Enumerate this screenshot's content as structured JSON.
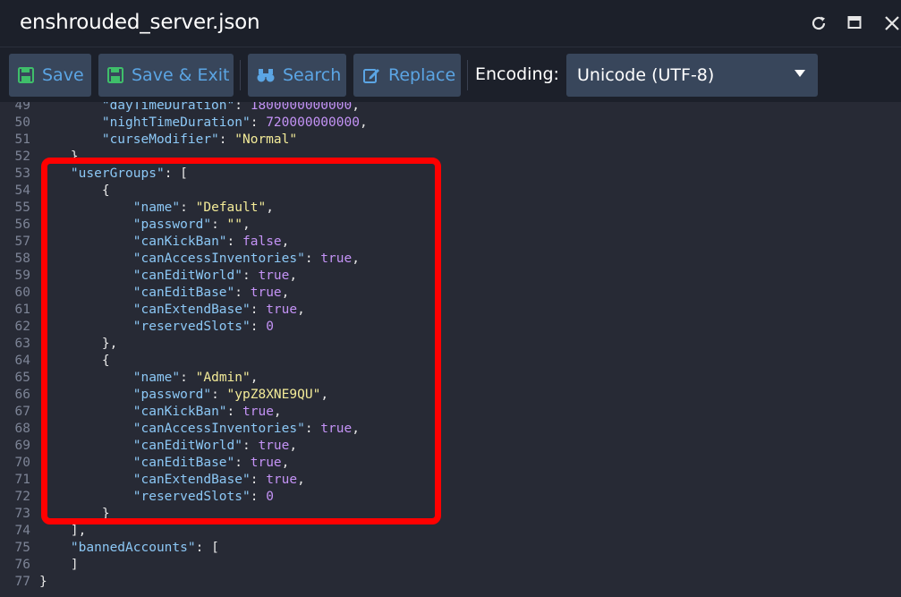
{
  "window": {
    "title": "enshrouded_server.json",
    "controls": [
      "refresh-icon",
      "maximize-icon",
      "close-icon"
    ]
  },
  "toolbar": {
    "save_label": "Save",
    "save_exit_label": "Save & Exit",
    "search_label": "Search",
    "replace_label": "Replace",
    "encoding_label": "Encoding:",
    "encoding_value": "Unicode (UTF-8)"
  },
  "colors": {
    "key": "#8cc8f6",
    "string": "#f3eb98",
    "number_bool": "#c493f6",
    "highlight_border": "#ff0000",
    "button_text": "#5ba5e4"
  },
  "editor": {
    "lines": [
      {
        "num": "49",
        "tokens": [
          {
            "t": "        ",
            "c": "p"
          },
          {
            "t": "\"dayTimeDuration\"",
            "c": "k"
          },
          {
            "t": ": ",
            "c": "p"
          },
          {
            "t": "1800000000000",
            "c": "n"
          },
          {
            "t": ",",
            "c": "p"
          }
        ]
      },
      {
        "num": "50",
        "tokens": [
          {
            "t": "        ",
            "c": "p"
          },
          {
            "t": "\"nightTimeDuration\"",
            "c": "k"
          },
          {
            "t": ": ",
            "c": "p"
          },
          {
            "t": "720000000000",
            "c": "n"
          },
          {
            "t": ",",
            "c": "p"
          }
        ]
      },
      {
        "num": "51",
        "tokens": [
          {
            "t": "        ",
            "c": "p"
          },
          {
            "t": "\"curseModifier\"",
            "c": "k"
          },
          {
            "t": ": ",
            "c": "p"
          },
          {
            "t": "\"Normal\"",
            "c": "s"
          }
        ]
      },
      {
        "num": "52",
        "tokens": [
          {
            "t": "    }",
            "c": "p"
          }
        ]
      },
      {
        "num": "53",
        "tokens": [
          {
            "t": "    ",
            "c": "p"
          },
          {
            "t": "\"userGroups\"",
            "c": "k"
          },
          {
            "t": ": [",
            "c": "p"
          }
        ]
      },
      {
        "num": "54",
        "tokens": [
          {
            "t": "        {",
            "c": "p"
          }
        ]
      },
      {
        "num": "55",
        "tokens": [
          {
            "t": "            ",
            "c": "p"
          },
          {
            "t": "\"name\"",
            "c": "k"
          },
          {
            "t": ": ",
            "c": "p"
          },
          {
            "t": "\"Default\"",
            "c": "s"
          },
          {
            "t": ",",
            "c": "p"
          }
        ]
      },
      {
        "num": "56",
        "tokens": [
          {
            "t": "            ",
            "c": "p"
          },
          {
            "t": "\"password\"",
            "c": "k"
          },
          {
            "t": ": ",
            "c": "p"
          },
          {
            "t": "\"\"",
            "c": "s"
          },
          {
            "t": ",",
            "c": "p"
          }
        ]
      },
      {
        "num": "57",
        "tokens": [
          {
            "t": "            ",
            "c": "p"
          },
          {
            "t": "\"canKickBan\"",
            "c": "k"
          },
          {
            "t": ": ",
            "c": "p"
          },
          {
            "t": "false",
            "c": "n"
          },
          {
            "t": ",",
            "c": "p"
          }
        ]
      },
      {
        "num": "58",
        "tokens": [
          {
            "t": "            ",
            "c": "p"
          },
          {
            "t": "\"canAccessInventories\"",
            "c": "k"
          },
          {
            "t": ": ",
            "c": "p"
          },
          {
            "t": "true",
            "c": "n"
          },
          {
            "t": ",",
            "c": "p"
          }
        ]
      },
      {
        "num": "59",
        "tokens": [
          {
            "t": "            ",
            "c": "p"
          },
          {
            "t": "\"canEditWorld\"",
            "c": "k"
          },
          {
            "t": ": ",
            "c": "p"
          },
          {
            "t": "true",
            "c": "n"
          },
          {
            "t": ",",
            "c": "p"
          }
        ]
      },
      {
        "num": "60",
        "tokens": [
          {
            "t": "            ",
            "c": "p"
          },
          {
            "t": "\"canEditBase\"",
            "c": "k"
          },
          {
            "t": ": ",
            "c": "p"
          },
          {
            "t": "true",
            "c": "n"
          },
          {
            "t": ",",
            "c": "p"
          }
        ]
      },
      {
        "num": "61",
        "tokens": [
          {
            "t": "            ",
            "c": "p"
          },
          {
            "t": "\"canExtendBase\"",
            "c": "k"
          },
          {
            "t": ": ",
            "c": "p"
          },
          {
            "t": "true",
            "c": "n"
          },
          {
            "t": ",",
            "c": "p"
          }
        ]
      },
      {
        "num": "62",
        "tokens": [
          {
            "t": "            ",
            "c": "p"
          },
          {
            "t": "\"reservedSlots\"",
            "c": "k"
          },
          {
            "t": ": ",
            "c": "p"
          },
          {
            "t": "0",
            "c": "n"
          }
        ]
      },
      {
        "num": "63",
        "tokens": [
          {
            "t": "        },",
            "c": "p"
          }
        ]
      },
      {
        "num": "64",
        "tokens": [
          {
            "t": "        {",
            "c": "p"
          }
        ]
      },
      {
        "num": "65",
        "tokens": [
          {
            "t": "            ",
            "c": "p"
          },
          {
            "t": "\"name\"",
            "c": "k"
          },
          {
            "t": ": ",
            "c": "p"
          },
          {
            "t": "\"Admin\"",
            "c": "s"
          },
          {
            "t": ",",
            "c": "p"
          }
        ]
      },
      {
        "num": "66",
        "tokens": [
          {
            "t": "            ",
            "c": "p"
          },
          {
            "t": "\"password\"",
            "c": "k"
          },
          {
            "t": ": ",
            "c": "p"
          },
          {
            "t": "\"ypZ8XNE9QU\"",
            "c": "s"
          },
          {
            "t": ",",
            "c": "p"
          }
        ]
      },
      {
        "num": "67",
        "tokens": [
          {
            "t": "            ",
            "c": "p"
          },
          {
            "t": "\"canKickBan\"",
            "c": "k"
          },
          {
            "t": ": ",
            "c": "p"
          },
          {
            "t": "true",
            "c": "n"
          },
          {
            "t": ",",
            "c": "p"
          }
        ]
      },
      {
        "num": "68",
        "tokens": [
          {
            "t": "            ",
            "c": "p"
          },
          {
            "t": "\"canAccessInventories\"",
            "c": "k"
          },
          {
            "t": ": ",
            "c": "p"
          },
          {
            "t": "true",
            "c": "n"
          },
          {
            "t": ",",
            "c": "p"
          }
        ]
      },
      {
        "num": "69",
        "tokens": [
          {
            "t": "            ",
            "c": "p"
          },
          {
            "t": "\"canEditWorld\"",
            "c": "k"
          },
          {
            "t": ": ",
            "c": "p"
          },
          {
            "t": "true",
            "c": "n"
          },
          {
            "t": ",",
            "c": "p"
          }
        ]
      },
      {
        "num": "70",
        "tokens": [
          {
            "t": "            ",
            "c": "p"
          },
          {
            "t": "\"canEditBase\"",
            "c": "k"
          },
          {
            "t": ": ",
            "c": "p"
          },
          {
            "t": "true",
            "c": "n"
          },
          {
            "t": ",",
            "c": "p"
          }
        ]
      },
      {
        "num": "71",
        "tokens": [
          {
            "t": "            ",
            "c": "p"
          },
          {
            "t": "\"canExtendBase\"",
            "c": "k"
          },
          {
            "t": ": ",
            "c": "p"
          },
          {
            "t": "true",
            "c": "n"
          },
          {
            "t": ",",
            "c": "p"
          }
        ]
      },
      {
        "num": "72",
        "tokens": [
          {
            "t": "            ",
            "c": "p"
          },
          {
            "t": "\"reservedSlots\"",
            "c": "k"
          },
          {
            "t": ": ",
            "c": "p"
          },
          {
            "t": "0",
            "c": "n"
          }
        ]
      },
      {
        "num": "73",
        "tokens": [
          {
            "t": "        }",
            "c": "p"
          }
        ]
      },
      {
        "num": "74",
        "tokens": [
          {
            "t": "    ],",
            "c": "p"
          }
        ]
      },
      {
        "num": "75",
        "tokens": [
          {
            "t": "    ",
            "c": "p"
          },
          {
            "t": "\"bannedAccounts\"",
            "c": "k"
          },
          {
            "t": ": [",
            "c": "p"
          }
        ]
      },
      {
        "num": "76",
        "tokens": [
          {
            "t": "    ]",
            "c": "p"
          }
        ]
      },
      {
        "num": "77",
        "tokens": [
          {
            "t": "}",
            "c": "p"
          }
        ]
      }
    ]
  }
}
